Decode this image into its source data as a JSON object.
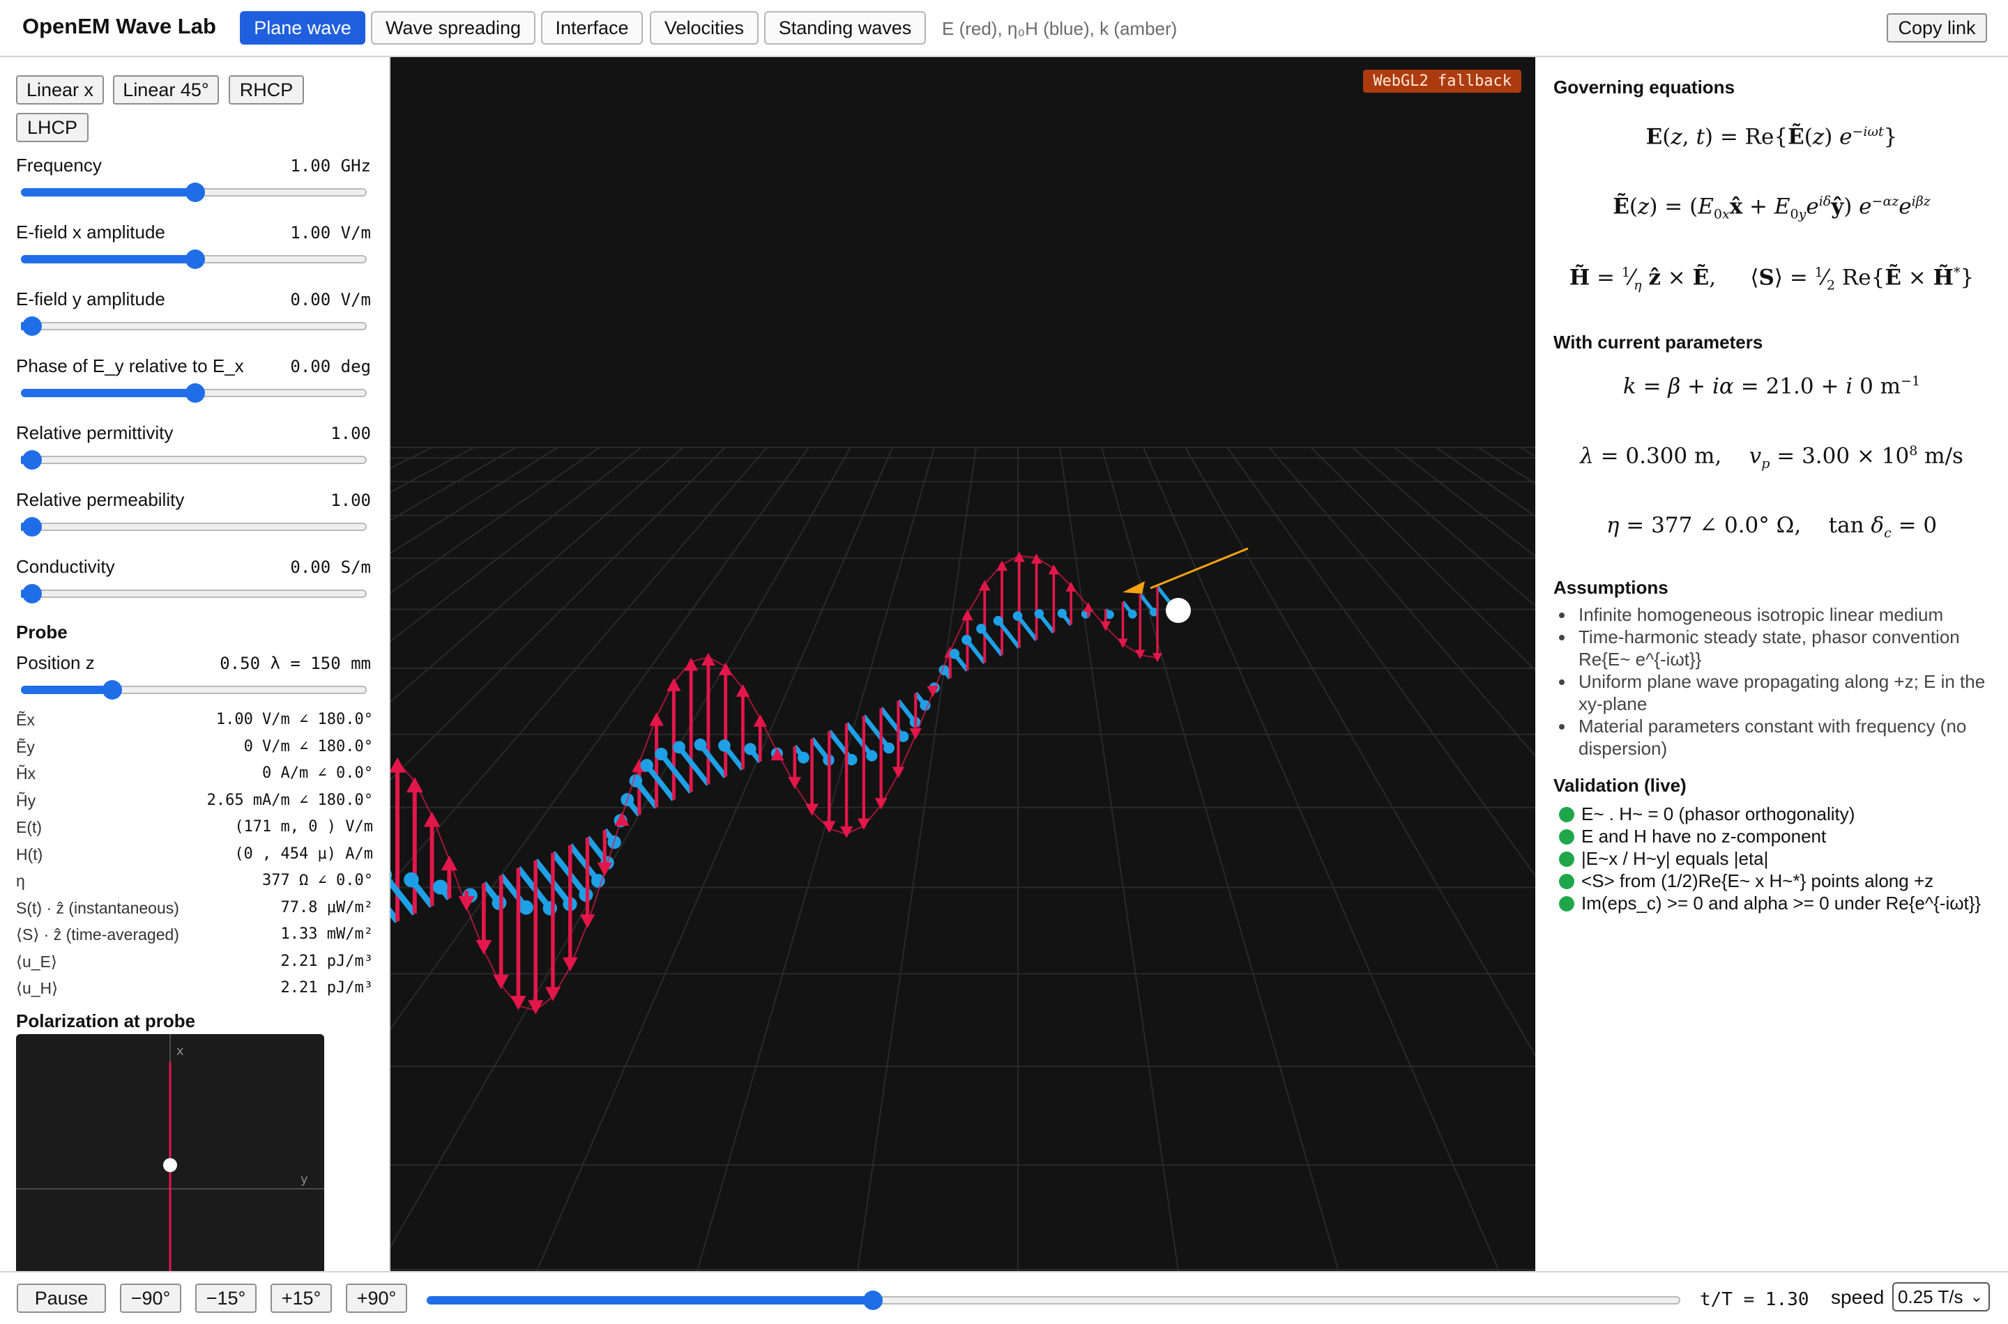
{
  "header": {
    "title": "OpenEM Wave Lab",
    "tabs": [
      {
        "label": "Plane wave",
        "active": true
      },
      {
        "label": "Wave spreading",
        "active": false
      },
      {
        "label": "Interface",
        "active": false
      },
      {
        "label": "Velocities",
        "active": false
      },
      {
        "label": "Standing waves",
        "active": false
      }
    ],
    "legend_note": "E (red), η₀H (blue), k (amber)",
    "copy_link": "Copy link"
  },
  "presets": [
    "Linear x",
    "Linear 45°",
    "RHCP",
    "LHCP"
  ],
  "controls": [
    {
      "label": "Frequency",
      "value": "1.00 GHz",
      "fraction": 0.5
    },
    {
      "label": "E-field x amplitude",
      "value": "1.00 V/m",
      "fraction": 0.5
    },
    {
      "label": "E-field y amplitude",
      "value": "0.00 V/m",
      "fraction": 0.0
    },
    {
      "label": "Phase of E_y relative to E_x",
      "value": "0.00 deg",
      "fraction": 0.5
    },
    {
      "label": "Relative permittivity",
      "value": "1.00",
      "fraction": 0.0
    },
    {
      "label": "Relative permeability",
      "value": "1.00",
      "fraction": 0.0
    },
    {
      "label": "Conductivity",
      "value": "0.00 S/m",
      "fraction": 0.0
    }
  ],
  "probe": {
    "title": "Probe",
    "position_label": "Position z",
    "position_value": "0.50 λ = 150 mm",
    "position_fraction": 0.26,
    "rows": [
      {
        "label": "Ẽx",
        "value": "1.00 V/m ∠ 180.0°"
      },
      {
        "label": "Ẽy",
        "value": "0 V/m ∠ 180.0°"
      },
      {
        "label": "H̃x",
        "value": "0 A/m ∠ 0.0°"
      },
      {
        "label": "H̃y",
        "value": "2.65 mA/m ∠ 180.0°"
      },
      {
        "label": "E(t)",
        "value": "(171 m, 0 ) V/m"
      },
      {
        "label": "H(t)",
        "value": "(0 , 454 μ) A/m"
      },
      {
        "label": "η",
        "value": "377 Ω ∠ 0.0°"
      },
      {
        "label": "S(t) · ẑ (instantaneous)",
        "value": "77.8 μW/m²"
      },
      {
        "label": "⟨S⟩ · ẑ (time-averaged)",
        "value": "1.33 mW/m²"
      },
      {
        "label": "⟨u_E⟩",
        "value": "2.21 pJ/m³"
      },
      {
        "label": "⟨u_H⟩",
        "value": "2.21 pJ/m³"
      }
    ]
  },
  "polarization": {
    "title": "Polarization at probe",
    "axis_x": "x",
    "axis_y": "y"
  },
  "viewport": {
    "badge": "WebGL2 fallback",
    "e_color": "#e3174a",
    "h_color": "#1ea0e6",
    "k_color": "#f5a40e"
  },
  "right": {
    "gov_title": "Governing equations",
    "current_title": "With current parameters",
    "assumptions_title": "Assumptions",
    "assumptions": [
      "Infinite homogeneous isotropic linear medium",
      "Time-harmonic steady state, phasor convention Re{E~ e^{-iωt}}",
      "Uniform plane wave propagating along +z; E in the xy-plane",
      "Material parameters constant with frequency (no dispersion)"
    ],
    "validation_title": "Validation (live)",
    "validation": [
      "E~ . H~ = 0 (phasor orthogonality)",
      "E and H have no z-component",
      "|E~x / H~y| equals |eta|",
      "<S> from (1/2)Re{E~ x H~*} points along +z",
      "Im(eps_c) >= 0 and alpha >= 0 under Re{e^{-iωt}}"
    ]
  },
  "current_params": {
    "k": "21.0",
    "alpha": "0",
    "lambda": "0.300 m",
    "vp_mant": "3.00",
    "vp_exp": "8",
    "eta": "377",
    "eta_angle": "0.0°",
    "tan_dc": "0"
  },
  "bottom": {
    "pause": "Pause",
    "steps": [
      "−90°",
      "−15°",
      "+15°",
      "+90°"
    ],
    "time_fraction": 0.355,
    "time_readout": "t/T = 1.30",
    "speed_label": "speed",
    "speed_value": "0.25 T/s"
  }
}
